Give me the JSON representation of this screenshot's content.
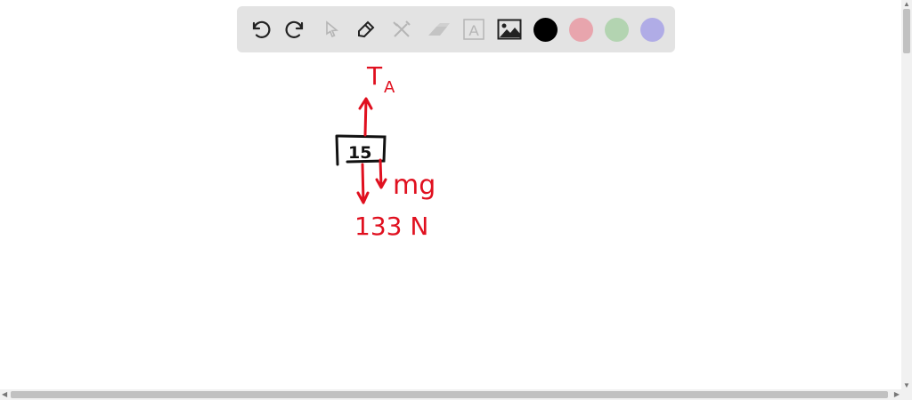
{
  "toolbar": {
    "tools": [
      "undo-icon",
      "redo-icon",
      "select-icon",
      "pen-icon",
      "tools-icon",
      "eraser-icon",
      "text-icon",
      "image-icon"
    ],
    "text_tool_glyph": "A",
    "colors": [
      "#000000",
      "#e8a5ad",
      "#b3d4b1",
      "#b0ace6"
    ]
  },
  "drawing": {
    "ink_color": "#e0101f",
    "tension_label": "T",
    "tension_subscript": "A",
    "mass_label": "15",
    "weight_label": "mg",
    "weight_value": "133 N"
  }
}
